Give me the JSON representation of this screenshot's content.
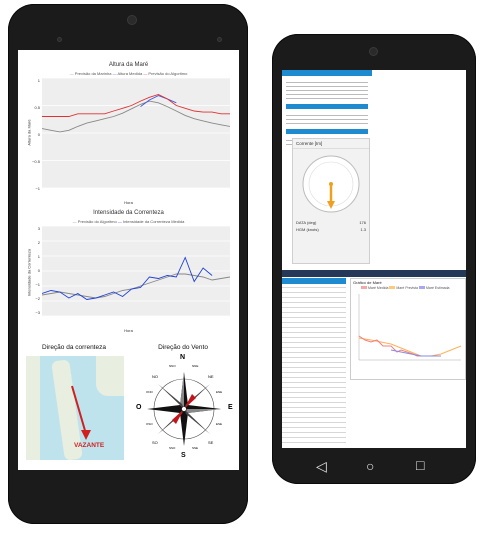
{
  "left_phone": {
    "tide_chart": {
      "title": "Altura da Maré",
      "legend": [
        "Previsão da Marinha",
        "Altura Medida",
        "Previsão do Algoritmo"
      ],
      "ylabel": "Altura da Maré",
      "xlabel": "Hora",
      "y_ticks": [
        "1",
        "0.5",
        "0",
        "−0.5",
        "−1"
      ]
    },
    "current_chart": {
      "title": "Intensidade da Correnteza",
      "legend": [
        "Previsão do Algoritmo",
        "Intensidade da Correnteza Medida"
      ],
      "ylabel": "Intensidade da Correnteza",
      "xlabel": "Hora",
      "y_ticks": [
        "3",
        "2",
        "1",
        "0",
        "−1",
        "−2",
        "−3"
      ]
    },
    "current_direction": {
      "title": "Direção da correnteza",
      "status": "VAZANTE"
    },
    "wind_direction": {
      "title": "Direção do Vento",
      "cardinals": {
        "n": "N",
        "s": "S",
        "e": "E",
        "o": "O"
      },
      "intercardinals": {
        "ne": "NE",
        "no": "NO",
        "se": "SE",
        "so": "SO"
      },
      "minor": [
        "NNE",
        "ENE",
        "ESE",
        "SSE",
        "SSO",
        "OSO",
        "ONO",
        "NNO"
      ]
    }
  },
  "right_phone": {
    "current_panel": {
      "title": "Corrente [Im]",
      "rows": [
        {
          "label": "DATA (deg)",
          "value": "176"
        },
        {
          "label": "HGM (knots)",
          "value": "1.3"
        }
      ]
    },
    "tide_table_title": "ALTURA DA MARÉ",
    "tide_chart_title": "Gráfico de Maré",
    "tide_chart_legend": [
      "Maré Medida",
      "Maré Prevista",
      "Maré Estimada"
    ],
    "nav": {
      "back": "◁",
      "home": "○",
      "recent": "□"
    }
  },
  "chart_data": [
    {
      "type": "line",
      "title": "Altura da Maré",
      "xlabel": "Hora",
      "ylabel": "Altura da Maré",
      "ylim": [
        -1,
        1
      ],
      "series": [
        {
          "name": "Previsão da Marinha",
          "color": "#888888",
          "values": [
            0.08,
            0.05,
            0.02,
            0.05,
            0.12,
            0.18,
            0.22,
            0.26,
            0.3,
            0.36,
            0.44,
            0.52,
            0.58,
            0.55,
            0.48,
            0.4,
            0.32,
            0.26,
            0.22,
            0.18,
            0.15,
            0.12
          ]
        },
        {
          "name": "Altura Medida",
          "color": "#3b5bdb",
          "values": [
            null,
            null,
            null,
            null,
            null,
            null,
            null,
            null,
            null,
            null,
            null,
            0.48,
            0.6,
            0.68,
            0.62,
            0.55,
            null,
            null,
            null,
            null,
            null,
            null
          ]
        },
        {
          "name": "Previsão do Algoritmo",
          "color": "#e03131",
          "values": [
            0.3,
            0.3,
            0.3,
            0.3,
            0.35,
            0.35,
            0.35,
            0.35,
            0.4,
            0.45,
            0.5,
            0.58,
            0.65,
            0.7,
            0.62,
            0.5,
            0.45,
            0.4,
            0.38,
            0.38,
            0.35,
            0.35
          ]
        }
      ]
    },
    {
      "type": "line",
      "title": "Intensidade da Correnteza",
      "xlabel": "Hora",
      "ylabel": "Intensidade da Correnteza",
      "ylim": [
        -3,
        3
      ],
      "series": [
        {
          "name": "Previsão do Algoritmo",
          "color": "#888888",
          "values": [
            -1.6,
            -1.5,
            -1.4,
            -1.5,
            -1.6,
            -1.7,
            -1.8,
            -1.7,
            -1.5,
            -1.3,
            -1.2,
            -1.0,
            -0.8,
            -0.6,
            -0.4,
            -0.2,
            -0.2,
            -0.3,
            -0.4,
            -0.6,
            -0.5,
            -0.4
          ]
        },
        {
          "name": "Intensidade da Correnteza Medida",
          "color": "#1c3fd8",
          "values": [
            -1.5,
            -1.3,
            -1.4,
            -1.8,
            -1.5,
            -1.9,
            -1.8,
            -1.6,
            -1.4,
            -1.7,
            -1.2,
            -1.1,
            -0.4,
            -0.5,
            -0.3,
            -0.4,
            0.9,
            -0.7,
            0.2,
            -0.3,
            null,
            null
          ]
        }
      ]
    }
  ]
}
